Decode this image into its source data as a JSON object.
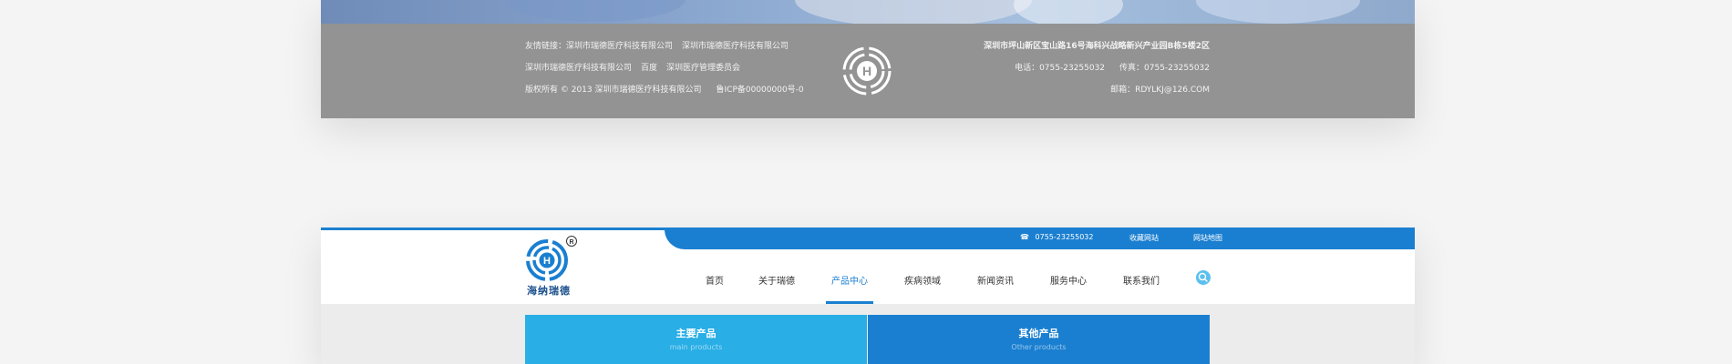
{
  "footer": {
    "links_label": "友情链接：",
    "links_row1": [
      "深圳市瑞德医疗科技有限公司",
      "深圳市瑞德医疗科技有限公司"
    ],
    "links_row2": [
      "深圳市瑞德医疗科技有限公司",
      "百度",
      "深圳医疗管理委员会"
    ],
    "copyright": "版权所有 © 2013 深圳市瑞德医疗科技有限公司",
    "icp": "鲁ICP备00000000号-0",
    "address": "深圳市坪山新区宝山路16号海科兴战略新兴产业园B栋5楼2区",
    "phone": "电话：0755-23255032",
    "fax": "传真：0755-23255032",
    "email": "邮箱：RDYLKJ@126.COM"
  },
  "header": {
    "phone": "0755-23255032",
    "favorite": "收藏网站",
    "sitemap": "网站地图",
    "logo_text": "海纳瑞德",
    "logo_mark": "R",
    "nav": [
      "首页",
      "关于瑞德",
      "产品中心",
      "疾病领域",
      "新闻资讯",
      "服务中心",
      "联系我们"
    ],
    "active_nav": "产品中心"
  },
  "tabs": [
    {
      "title": "主要产品",
      "subtitle": "main products"
    },
    {
      "title": "其他产品",
      "subtitle": "Other products"
    }
  ],
  "colors": {
    "footer_bg": "#939393",
    "brand_blue": "#1a7fd0",
    "tab_light": "#29aee6",
    "tab_dark": "#1a7fd0",
    "search_bg": "#5cc0ee"
  }
}
